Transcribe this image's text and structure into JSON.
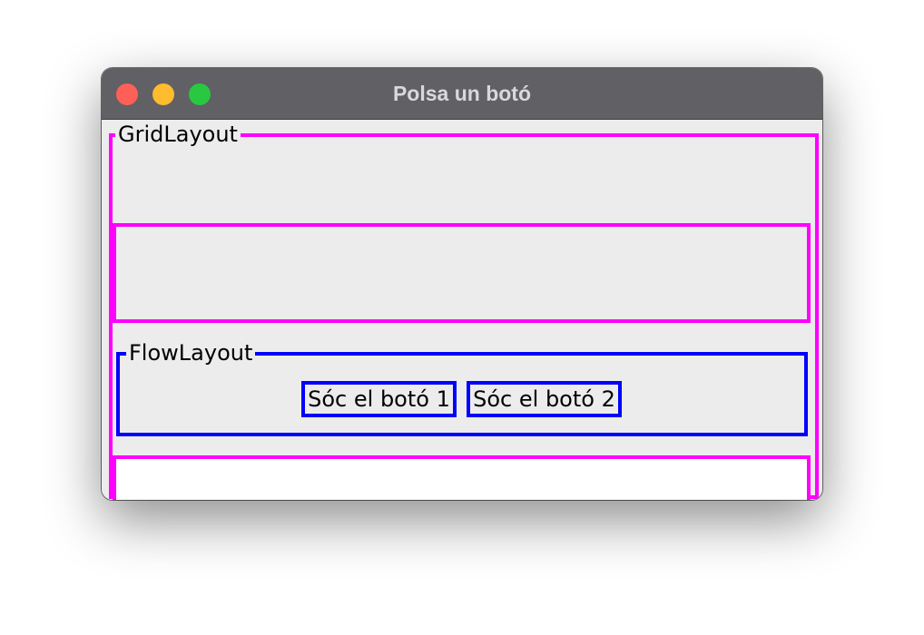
{
  "window": {
    "title": "Polsa un botó"
  },
  "grid_panel": {
    "legend": "GridLayout"
  },
  "flow_panel": {
    "legend": "FlowLayout",
    "buttons": [
      {
        "label": "Sóc el botó 1"
      },
      {
        "label": "Sóc el botó 2"
      }
    ]
  },
  "colors": {
    "grid_border": "#ff00ff",
    "flow_border": "#0000ff",
    "titlebar": "#616064"
  }
}
